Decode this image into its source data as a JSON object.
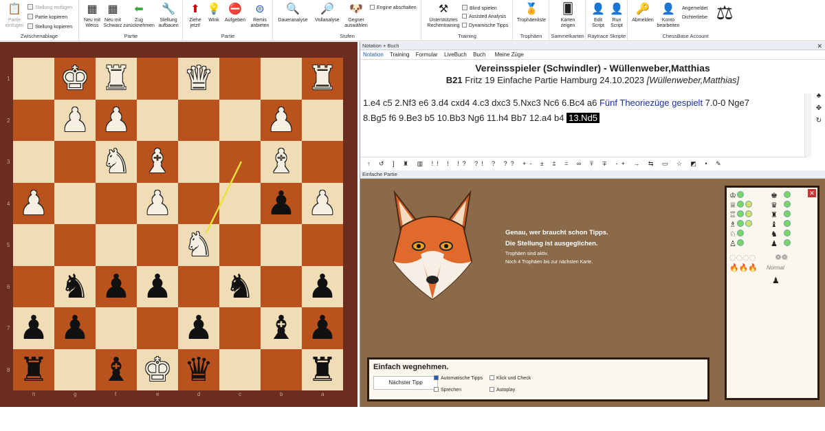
{
  "ribbon": {
    "clipboard": {
      "label": "Zwischenablage",
      "paste": "Partie einfügen",
      "paste_pos": "Stellung einfügen",
      "copy_game": "Partie kopieren",
      "copy_pos": "Stellung kopieren"
    },
    "game1": {
      "label": "Partie",
      "new_white": "Neu mit Weiss",
      "new_black": "Neu mit Schwarz",
      "take_back": "Zug zurücknehmen",
      "setup": "Stellung aufbauen"
    },
    "game2": {
      "label": "Partie",
      "move_now": "Ziehe jetzt!",
      "hint": "Wink",
      "resign": "Aufgeben",
      "draw": "Remis anbieten"
    },
    "levels": {
      "label": "Stufen",
      "infinite": "Daueranalyse",
      "full": "Vollanalyse",
      "choose": "Gegner auswählen",
      "engine_off": "Engine abschalten"
    },
    "training": {
      "label": "Training",
      "assisted": "Unterstütztes Rechentraining",
      "blind": "Blind spielen",
      "assisted_analysis": "Assisted Analysis",
      "dyn_tips": "Dynamische Tipps"
    },
    "trophies": {
      "label": "Trophäen",
      "list": "Trophäenliste"
    },
    "cards": {
      "label": "Sammelkarten",
      "show": "Karten zeigen"
    },
    "scripts": {
      "label": "Raytrace Skripte",
      "edit": "Edit Script",
      "run": "Run Script"
    },
    "account": {
      "label": "ChessBase Account",
      "logout": "Abmelden",
      "edit": "Konto bearbeiten",
      "logged_in": "Angemeldet",
      "user": "Dichterliebe"
    }
  },
  "board": {
    "ranks": [
      "1",
      "2",
      "3",
      "4",
      "5",
      "6",
      "7",
      "8"
    ],
    "files": [
      "h",
      "g",
      "f",
      "e",
      "d",
      "c",
      "b",
      "a"
    ]
  },
  "notation": {
    "title": "Notation + Buch",
    "tabs": [
      "Notation",
      "Training",
      "Formular",
      "LiveBuch",
      "Buch",
      "Meine Züge"
    ],
    "header1": "Vereinsspieler (Schwindler) - Wüllenweber,Matthias",
    "header2_eco": "B21",
    "header2_rest": "Fritz 19 Einfache Partie Hamburg 24.10.2023",
    "header2_ann": "[Wüllenweber,Matthias]",
    "line1": "1.e4  c5  2.Nf3  e6  3.d4  cxd4  4.c3  dxc3  5.Nxc3  Nc6  6.Bc4  a6 ",
    "theory": "Fünf Theoriezüge gespielt",
    "line1b": "  7.0-0  Nge7",
    "line2": "8.Bg5  f6  9.Be3  b5  10.Bb3  Ng6  11.h4  Bb7  12.a4  b4 ",
    "current": "13.Nd5",
    "symbols": "↑ ↺ ] ♜ ▥ !! ! !? ?! ? ?? +- ± ⩲ = ∞ ⩱ ∓ -+ → ⇆ ▭ ☆ ◩ • ✎"
  },
  "easy_game": {
    "title": "Einfache Partie",
    "msg1": "Genau, wer braucht schon Tipps.",
    "msg2": "Die Stellung ist ausgeglichen.",
    "msg3": "Trophäen sind aktiv.",
    "msg4": "Noch 4 Trophäen bis zur nächsten Karte.",
    "tip_title": "Einfach wegnehmen.",
    "next_tip": "Nächster Tipp",
    "auto_tips": "Automatische Tipps",
    "speak": "Sprechen",
    "click_check": "Klick und Check",
    "autoplay": "Autoplay",
    "level": "Normal"
  },
  "colors": {
    "accent": "#1f5bb3",
    "light_sq": "#f1ddb5",
    "dark_sq": "#b9521c",
    "panel_bg": "#8b6a4a"
  }
}
